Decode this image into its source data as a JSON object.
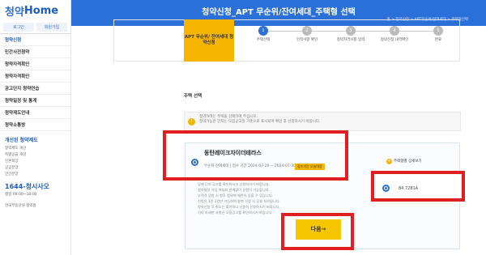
{
  "sidebar": {
    "logo_a": "청약",
    "logo_b": "Home",
    "auth": [
      "로그인",
      "회원가입"
    ],
    "menu": [
      "청약신청",
      "민간사전청약",
      "청약자격확인",
      "청약자격확인",
      "공고단지 청약연습",
      "청약일정 및 통계",
      "청약제도안내",
      "청약소통방"
    ],
    "sub_title": "개선된 청약제도",
    "sub_list": [
      "청약제도 개선",
      "특별공급 개선",
      "신혼희망",
      "공공분양",
      "민간분양"
    ],
    "call": "1644-청시사오",
    "call_info": "평일 09:00~18:00",
    "foot": "한국부동산원 청약홈"
  },
  "header": {
    "title": "청약신청_APT 무순위/잔여세대_주택형 선택",
    "breadcrumb": "홈 > 청약신청 > APT무순위/잔여세대 > 주택형선택"
  },
  "banner": {
    "label": "APT 무순위/ 잔여세대 청약신청"
  },
  "steps": [
    {
      "num": "1",
      "label": "주택선택",
      "active": true
    },
    {
      "num": "2",
      "label": "인적사항 확인",
      "active": false
    },
    {
      "num": "3",
      "label": "청약자격사항 입력",
      "active": false
    },
    {
      "num": "4",
      "label": "청약신청 내역확인",
      "active": false
    },
    {
      "num": "5",
      "label": "완료",
      "active": false
    }
  ],
  "section_title": "주택 선택",
  "notice": {
    "badge": "!",
    "lines": [
      "청약하려는 주택을 선택하여 주십시오.",
      "청약가능한 단지는 모집공고일 기준으로 표시되며 확인 후 신청하시기 바랍니다."
    ]
  },
  "housing": {
    "name": "동탄레이크자이더테라스",
    "meta": "무순위 잔여세대 | 접수 기간 2024-07-29 ~ 2024-07-30",
    "badge": "접수기간 오늘마감",
    "bullets": [
      "당해 단지 공고를 확인하시고 신청하시기 바랍니다.",
      "청약통장 가입 여부와 관계없이 신청이 가능합니다.",
      "부적격 당첨 시 향후 청약에 제한이 있을 수 있습니다.",
      "신청은 1인 1건만 가능하며 중복 신청 시 무효 처리됩니다.",
      "청약신청 후 취소는 불가하니 신중히 신청하시기 바랍니다.",
      "기타 자세한 사항은 모집공고를 확인하시기 바랍니다."
    ],
    "tag_button": "주택형별 상세보기",
    "type_option": "84.7281A"
  },
  "next_button": "다음→",
  "colors": {
    "primary": "#2b6fd8",
    "accent": "#f7b500",
    "highlight": "#e02020"
  }
}
